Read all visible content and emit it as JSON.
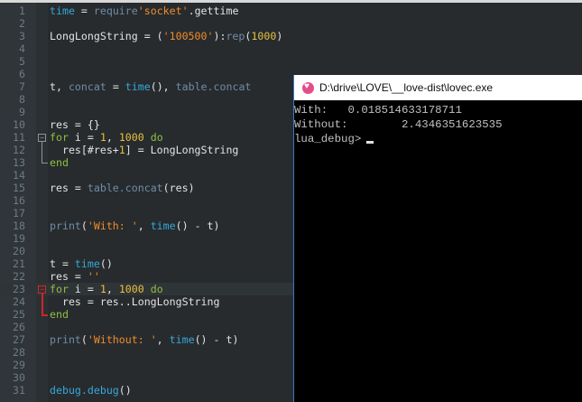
{
  "editor": {
    "current_line": 23,
    "lines": [
      [
        [
          "time",
          "cy"
        ],
        [
          " = ",
          "def"
        ],
        [
          "require",
          "fn"
        ],
        [
          "'socket'",
          "str"
        ],
        [
          ".gettime",
          "def"
        ]
      ],
      [],
      [
        [
          "LongLongString = (",
          "def"
        ],
        [
          "'100500'",
          "str"
        ],
        [
          "):",
          "def"
        ],
        [
          "rep",
          "fn"
        ],
        [
          "(",
          "def"
        ],
        [
          "1000",
          "num"
        ],
        [
          ")",
          "def"
        ]
      ],
      [],
      [],
      [],
      [
        [
          "t, ",
          "def"
        ],
        [
          "concat",
          "fn"
        ],
        [
          " = ",
          "def"
        ],
        [
          "time",
          "cy"
        ],
        [
          "(), ",
          "def"
        ],
        [
          "table.concat",
          "fn"
        ]
      ],
      [],
      [],
      [
        [
          "res = {}",
          "def"
        ]
      ],
      [
        [
          "for",
          "kw"
        ],
        [
          " i = ",
          "def"
        ],
        [
          "1",
          "num"
        ],
        [
          ", ",
          "def"
        ],
        [
          "1000",
          "num"
        ],
        [
          " ",
          "def"
        ],
        [
          "do",
          "kw"
        ]
      ],
      [
        [
          "  res[#res+",
          "def"
        ],
        [
          "1",
          "num"
        ],
        [
          "] = LongLongString",
          "def"
        ]
      ],
      [
        [
          "end",
          "kw"
        ]
      ],
      [],
      [
        [
          "res = ",
          "def"
        ],
        [
          "table.concat",
          "fn"
        ],
        [
          "(res)",
          "def"
        ]
      ],
      [],
      [],
      [
        [
          "print",
          "fn"
        ],
        [
          "(",
          "def"
        ],
        [
          "'With: '",
          "str"
        ],
        [
          ", ",
          "def"
        ],
        [
          "time",
          "cy"
        ],
        [
          "() - t)",
          "def"
        ]
      ],
      [],
      [],
      [
        [
          "t = ",
          "def"
        ],
        [
          "time",
          "cy"
        ],
        [
          "()",
          "def"
        ]
      ],
      [
        [
          "res = ",
          "def"
        ],
        [
          "''",
          "str"
        ]
      ],
      [
        [
          "for",
          "kw"
        ],
        [
          " i = ",
          "def"
        ],
        [
          "1",
          "num"
        ],
        [
          ", ",
          "def"
        ],
        [
          "1000",
          "num"
        ],
        [
          " ",
          "def"
        ],
        [
          "do",
          "kw"
        ]
      ],
      [
        [
          "  res = res..LongLongString",
          "def"
        ]
      ],
      [
        [
          "end",
          "kw"
        ]
      ],
      [],
      [
        [
          "print",
          "fn"
        ],
        [
          "(",
          "def"
        ],
        [
          "'Without: '",
          "str"
        ],
        [
          ", ",
          "def"
        ],
        [
          "time",
          "cy"
        ],
        [
          "() - t)",
          "def"
        ]
      ],
      [],
      [],
      [],
      [
        [
          "debug.debug",
          "cy"
        ],
        [
          "()",
          "def"
        ]
      ]
    ]
  },
  "terminal": {
    "title": "D:\\drive\\LOVE\\__love-dist\\lovec.exe",
    "lines": [
      "With:   0.018514633178711",
      "Without:        2.4346351623535"
    ],
    "prompt": "lua_debug>"
  }
}
